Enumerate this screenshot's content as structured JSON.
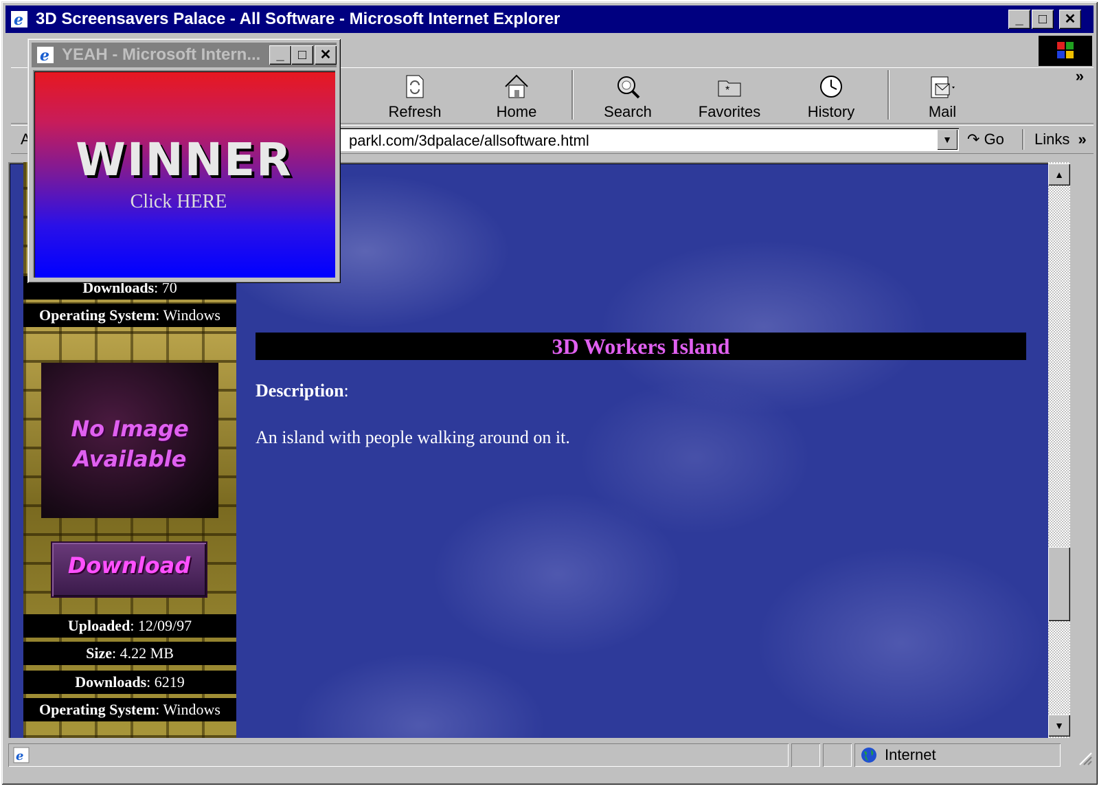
{
  "browser": {
    "title": "3D Screensavers Palace - All Software - Microsoft Internet Explorer",
    "toolbar": {
      "refresh": "Refresh",
      "home": "Home",
      "search": "Search",
      "favorites": "Favorites",
      "history": "History",
      "mail": "Mail"
    },
    "address_label": "A",
    "address": "parkl.com/3dpalace/allsoftware.html",
    "go": "Go",
    "links": "Links",
    "status": "Internet"
  },
  "popup": {
    "title": "YEAH - Microsoft Intern...",
    "headline": "WINNER",
    "cta": "Click HERE"
  },
  "sidebar": {
    "top_downloads": {
      "label": "Downloads",
      "value": ": 70"
    },
    "top_os": {
      "label": "Operating System",
      "value": ": Windows"
    },
    "no_image": "No Image Available",
    "download_button": "Download",
    "uploaded": {
      "label": "Uploaded",
      "value": ": 12/09/97"
    },
    "size": {
      "label": "Size",
      "value": ": 4.22 MB"
    },
    "downloads": {
      "label": "Downloads",
      "value": ": 6219"
    },
    "os": {
      "label": "Operating System",
      "value": ": Windows"
    }
  },
  "product": {
    "name": "3D Workers Island",
    "description_label": "Description",
    "description_colon": ":",
    "description": "An island with people walking around on it."
  },
  "colors": {
    "title_bar": "#000080",
    "page_background": "#2e3a9a",
    "heading_text": "#e060f0",
    "popup_gradient_top": "#e8181e",
    "popup_gradient_bottom": "#0000ff"
  }
}
